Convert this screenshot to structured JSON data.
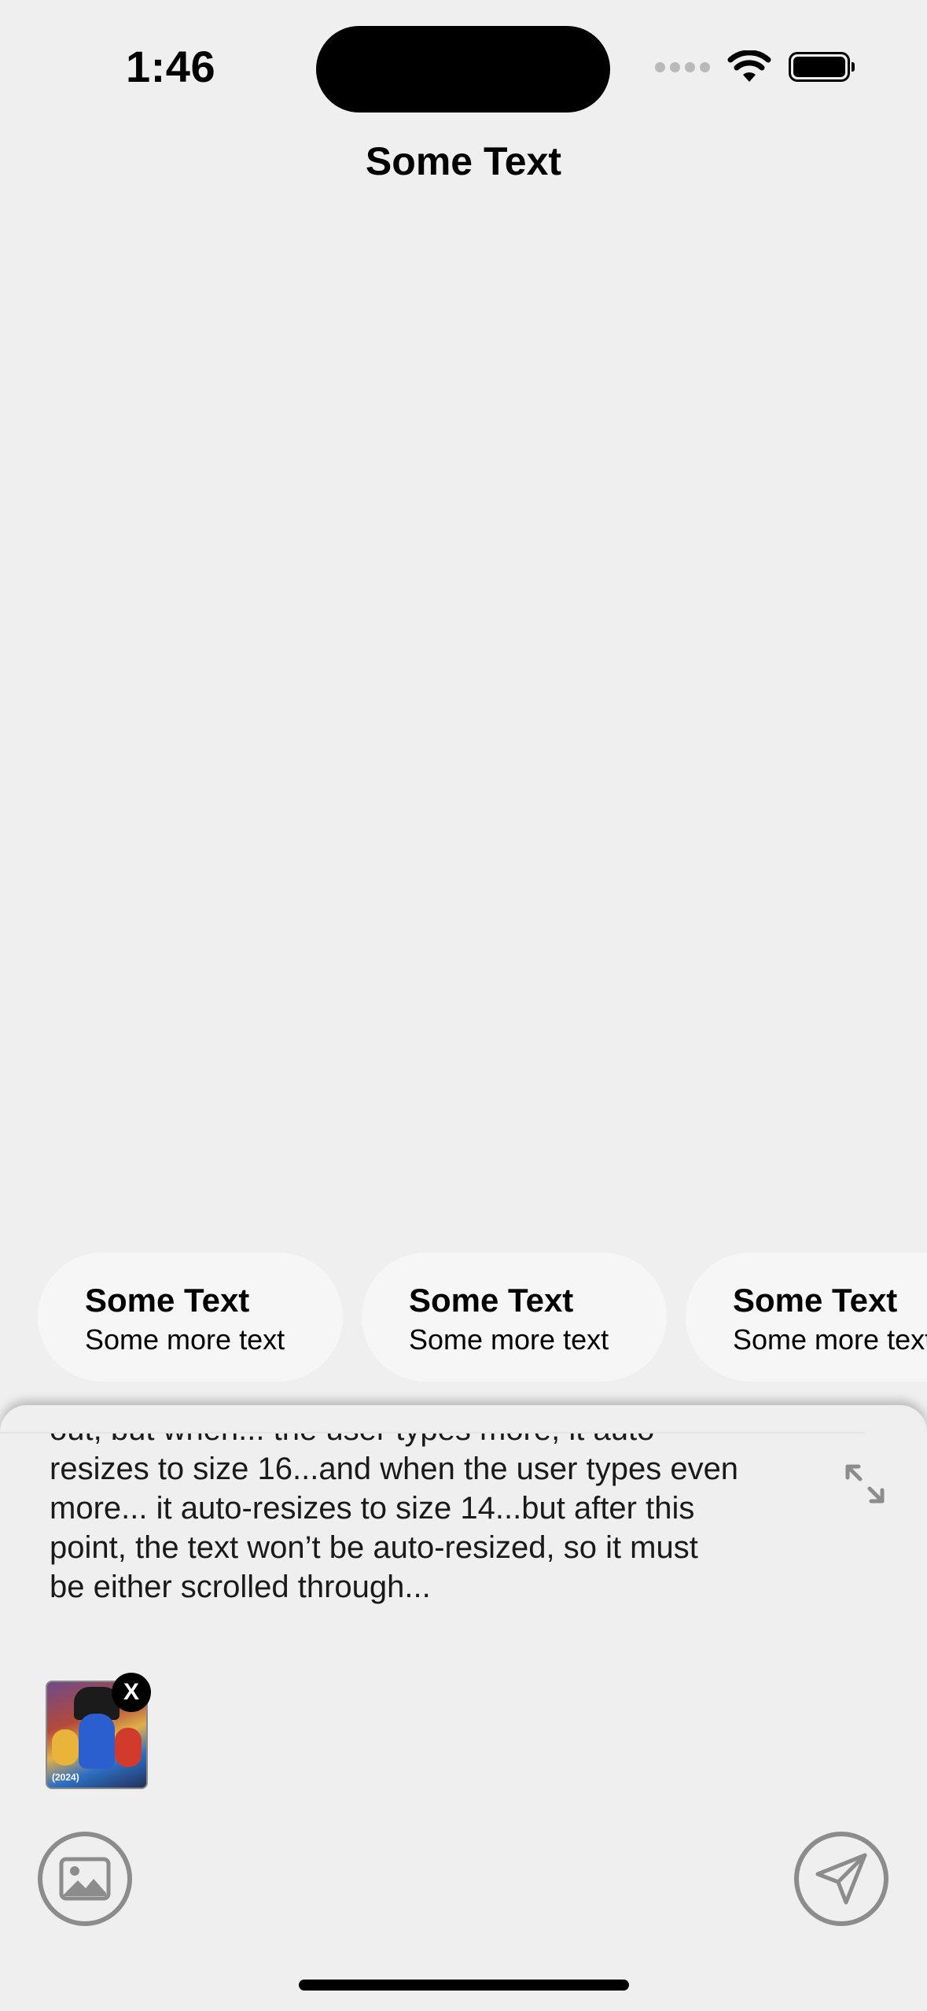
{
  "status_bar": {
    "time": "1:46"
  },
  "nav": {
    "title": "Some Text"
  },
  "chips": [
    {
      "title": "Some Text",
      "subtitle": "Some more text"
    },
    {
      "title": "Some Text",
      "subtitle": "Some more text"
    },
    {
      "title": "Some Text",
      "subtitle": "Some more text"
    }
  ],
  "composer": {
    "text_lines": [
      "out, but when... the user types more, it auto",
      "resizes to size 16...and when the user types even",
      "more... it auto-resizes to size 14...but after this",
      "point, the text won’t be auto-resized, so it must",
      "be either scrolled through..."
    ],
    "attachment": {
      "thumbnail_caption": "(2024)",
      "remove_label": "X"
    }
  },
  "icons": {
    "expand": "expand-arrows-icon",
    "photo": "photo-icon",
    "send": "paper-plane-icon",
    "wifi": "wifi-icon",
    "battery": "battery-icon",
    "cellular": "cellular-signal-icon"
  }
}
